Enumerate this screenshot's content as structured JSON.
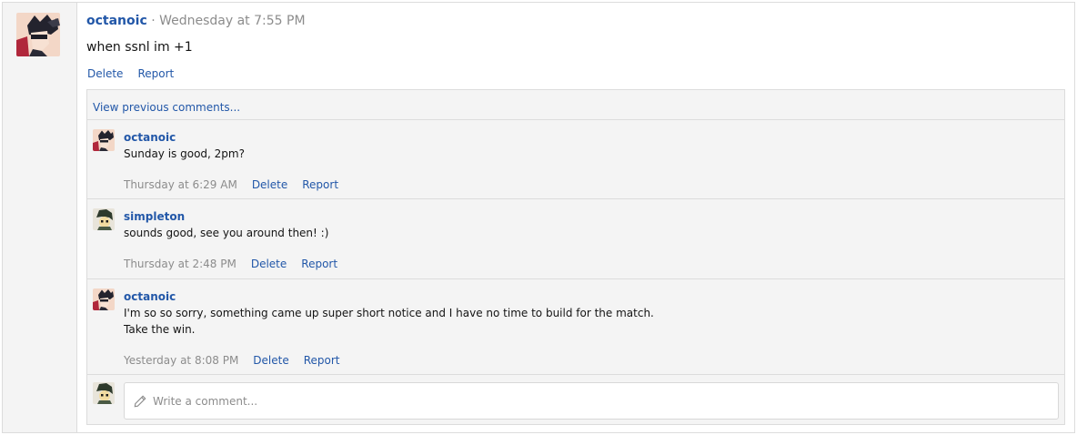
{
  "post": {
    "author": "octanoic",
    "meta": "· Wednesday at 7:55 PM",
    "body": "when ssnl im +1",
    "actions": {
      "delete": "Delete",
      "report": "Report"
    }
  },
  "comments_section": {
    "view_previous": "View previous comments...",
    "comments": [
      {
        "author": "octanoic",
        "lines": [
          "Sunday is good, 2pm?"
        ],
        "time": "Thursday at 6:29 AM",
        "delete": "Delete",
        "report": "Report"
      },
      {
        "author": "simpleton",
        "lines": [
          "sounds good, see you around then! :)"
        ],
        "time": "Thursday at 2:48 PM",
        "delete": "Delete",
        "report": "Report"
      },
      {
        "author": "octanoic",
        "lines": [
          "I'm so so sorry, something came up super short notice and I have no time to build for the match.",
          "Take the win."
        ],
        "time": "Yesterday at 8:08 PM",
        "delete": "Delete",
        "report": "Report"
      }
    ],
    "compose": {
      "placeholder": "Write a comment..."
    }
  },
  "colors": {
    "link": "#2257a8",
    "meta": "#8c8c8c",
    "panel": "#f4f4f4",
    "border": "#dcdcdc"
  },
  "icons": {
    "compose": "pencil-icon"
  }
}
